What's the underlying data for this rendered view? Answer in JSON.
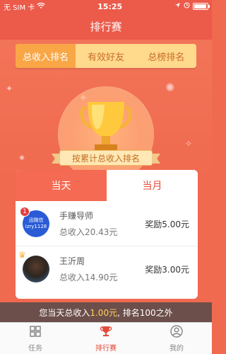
{
  "status": {
    "carrier": "无 SIM 卡",
    "time": "15:25"
  },
  "nav": {
    "title": "排行赛"
  },
  "tabs": [
    {
      "label": "总收入排名",
      "active": true
    },
    {
      "label": "有效好友",
      "active": false
    },
    {
      "label": "总榜排名",
      "active": false
    }
  ],
  "ribbon": "按累计总收入排名",
  "card": {
    "tabs": [
      {
        "label": "当天",
        "active": true
      },
      {
        "label": "当月",
        "active": false
      }
    ],
    "rows": [
      {
        "name": "手赚导师",
        "income": "总收入20.43元",
        "reward": "奖励5.00元",
        "avatar_line1": "迅微信",
        "avatar_line2": "izry1128",
        "rank": "1"
      },
      {
        "name": "王沂周",
        "income": "总收入14.90元",
        "reward": "奖励3.00元"
      }
    ]
  },
  "summary": {
    "prefix": "您当天总收入",
    "amount": "1.00元",
    "suffix": ", 排名100之外"
  },
  "bottomnav": [
    {
      "label": "任务",
      "icon": "grid-icon",
      "active": false
    },
    {
      "label": "排行赛",
      "icon": "trophy-icon",
      "active": true
    },
    {
      "label": "我的",
      "icon": "user-icon",
      "active": false
    }
  ],
  "colors": {
    "primary": "#ec5a4a",
    "tab_active": "#f9a646",
    "tab_bg": "#ffd98c",
    "summary_bg": "#6c4f4a",
    "highlight": "#ffd35a"
  }
}
